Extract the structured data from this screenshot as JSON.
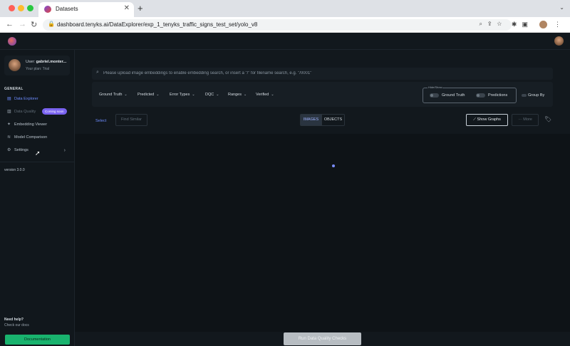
{
  "browser": {
    "tab_title": "Datasets",
    "tab_close": "✕",
    "new_tab": "+",
    "tab_menu": "⌄",
    "url": "dashboard.tenyks.ai/DataExplorer/exp_1_tenyks_traffic_signs_test_set/yolo_v8",
    "nav_back": "←",
    "nav_forward": "→",
    "nav_reload": "↻",
    "lock": "🔒",
    "omnibox_icons": "⌕⇪☆",
    "toolbar_icons": "✱▣"
  },
  "user": {
    "name_prefix": "User:",
    "name": "gabriel.monter...",
    "plan": "Your plan: Trial"
  },
  "sidebar": {
    "section": "GENERAL",
    "items": [
      {
        "label": "Data Explorer",
        "icon": "data-explorer-icon",
        "glyph": "▤"
      },
      {
        "label": "Data Quality",
        "icon": "data-quality-icon",
        "glyph": "▥"
      },
      {
        "label": "Embedding Viewer",
        "icon": "embedding-icon",
        "glyph": "✦"
      },
      {
        "label": "Model Comparison",
        "icon": "comparison-icon",
        "glyph": "≋"
      },
      {
        "label": "Settings",
        "icon": "gear-icon",
        "glyph": "⚙"
      }
    ],
    "coming_soon": "Coming soon",
    "chevron": "›",
    "version": "version 3.0.0",
    "help_title": "Need help?",
    "help_sub": "Check our docs",
    "documentation": "Documentation"
  },
  "search": {
    "icon": "⌕",
    "placeholder": "Please upload image embeddings to enable embedding search, or insert a \"/\" for filename search, e.g. \"/0001\""
  },
  "filters": [
    {
      "label": "Ground Truth"
    },
    {
      "label": "Predicted"
    },
    {
      "label": "Error Types"
    },
    {
      "label": "DQC"
    },
    {
      "label": "Ranges"
    },
    {
      "label": "Verified"
    }
  ],
  "filter_caret": "⌄",
  "hideshow": {
    "legend": "Hide/Show",
    "ground_truth": "Ground Truth",
    "predictions": "Predictions"
  },
  "group_by": "Group By",
  "actions": {
    "select": "Select",
    "find_similar": "Find Similar",
    "images": "IMAGES",
    "objects": "OBJECTS",
    "show_graphs": "Show Graphs",
    "show_graphs_icon": "⟋",
    "more": "More",
    "more_icon": "···",
    "tag_icon": "🏷"
  },
  "run_button": "Run Data Quality Checks",
  "colors": {
    "accent": "#6d8cff",
    "primary_button": "#19b36e",
    "badge": "#7a63f0"
  }
}
